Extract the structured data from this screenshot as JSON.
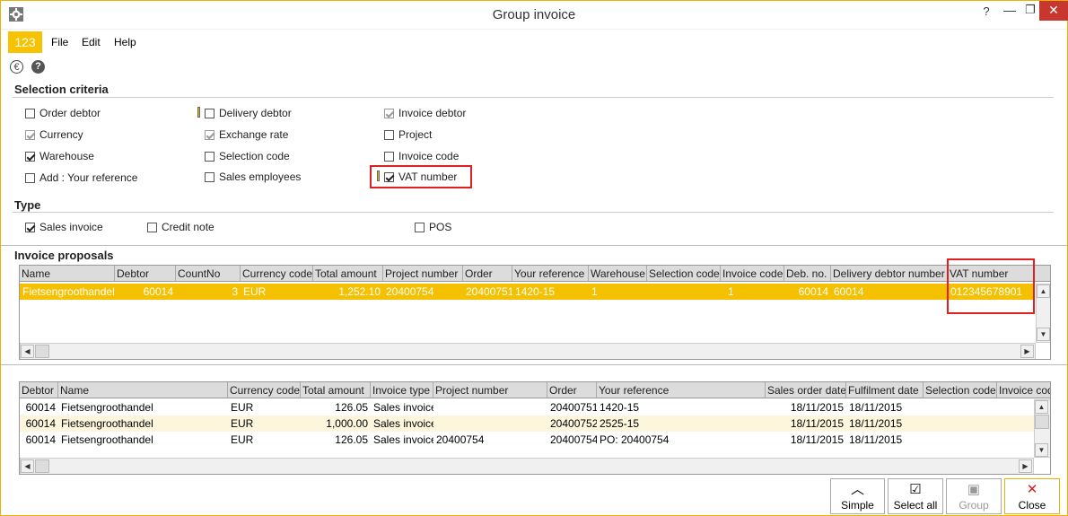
{
  "window": {
    "title": "Group invoice",
    "help": "?",
    "minimize": "—",
    "maximize": "❐",
    "close": "✕"
  },
  "logo": "123",
  "menu": {
    "file": "File",
    "edit": "Edit",
    "help": "Help"
  },
  "icons": {
    "euro": "€",
    "help": "?"
  },
  "selection": {
    "title": "Selection criteria",
    "items": [
      {
        "label": "Order debtor",
        "checked": false
      },
      {
        "label": "Currency",
        "checked": true
      },
      {
        "label": "Warehouse",
        "checked": true
      },
      {
        "label": "Add : Your reference",
        "checked": false
      },
      {
        "label": "Delivery debtor",
        "checked": false
      },
      {
        "label": "Exchange rate",
        "checked": true
      },
      {
        "label": "Selection code",
        "checked": false
      },
      {
        "label": "Sales employees",
        "checked": false
      },
      {
        "label": "Invoice debtor",
        "checked": true
      },
      {
        "label": "Project",
        "checked": false
      },
      {
        "label": "Invoice code",
        "checked": false
      },
      {
        "label": "VAT number",
        "checked": true
      }
    ]
  },
  "type": {
    "title": "Type",
    "items": [
      {
        "label": "Sales invoice",
        "checked": true
      },
      {
        "label": "Credit note",
        "checked": false
      },
      {
        "label": "POS",
        "checked": false
      }
    ]
  },
  "proposals": {
    "title": "Invoice proposals",
    "columns": [
      "Name",
      "Debtor",
      "CountNo",
      "Currency code",
      "Total amount",
      "Project number",
      "Order",
      "Your reference",
      "Warehouse",
      "Selection code",
      "Invoice code",
      "Deb. no.",
      "Delivery debtor number",
      "VAT number"
    ],
    "rows": [
      [
        "Fietsengroothandel",
        "60014",
        "3",
        "EUR",
        "1,252.10",
        "20400754",
        "20400751",
        "1420-15",
        "1",
        "",
        "1",
        "60014",
        "60014",
        "012345678901"
      ]
    ]
  },
  "lines": {
    "columns": [
      "Debtor",
      "Name",
      "Currency code",
      "Total amount",
      "Invoice type",
      "Project number",
      "Order",
      "Your reference",
      "Sales order date",
      "Fulfilment date",
      "Selection code",
      "Invoice code"
    ],
    "rows": [
      [
        "60014",
        "Fietsengroothandel",
        "EUR",
        "126.05",
        "Sales invoice",
        "",
        "20400751",
        "1420-15",
        "18/11/2015",
        "18/11/2015",
        "",
        ""
      ],
      [
        "60014",
        "Fietsengroothandel",
        "EUR",
        "1,000.00",
        "Sales invoice",
        "",
        "20400752",
        "2525-15",
        "18/11/2015",
        "18/11/2015",
        "",
        ""
      ],
      [
        "60014",
        "Fietsengroothandel",
        "EUR",
        "126.05",
        "Sales invoice",
        "20400754",
        "20400754",
        "PO: 20400754",
        "18/11/2015",
        "18/11/2015",
        "",
        ""
      ]
    ]
  },
  "buttons": {
    "simple": "Simple",
    "select_all": "Select all",
    "group": "Group",
    "close": "Close"
  },
  "colors": {
    "accent": "#f7c200",
    "selected_row": "#f4c000",
    "alt_row": "#fdf6dc",
    "highlight": "#e02020"
  }
}
